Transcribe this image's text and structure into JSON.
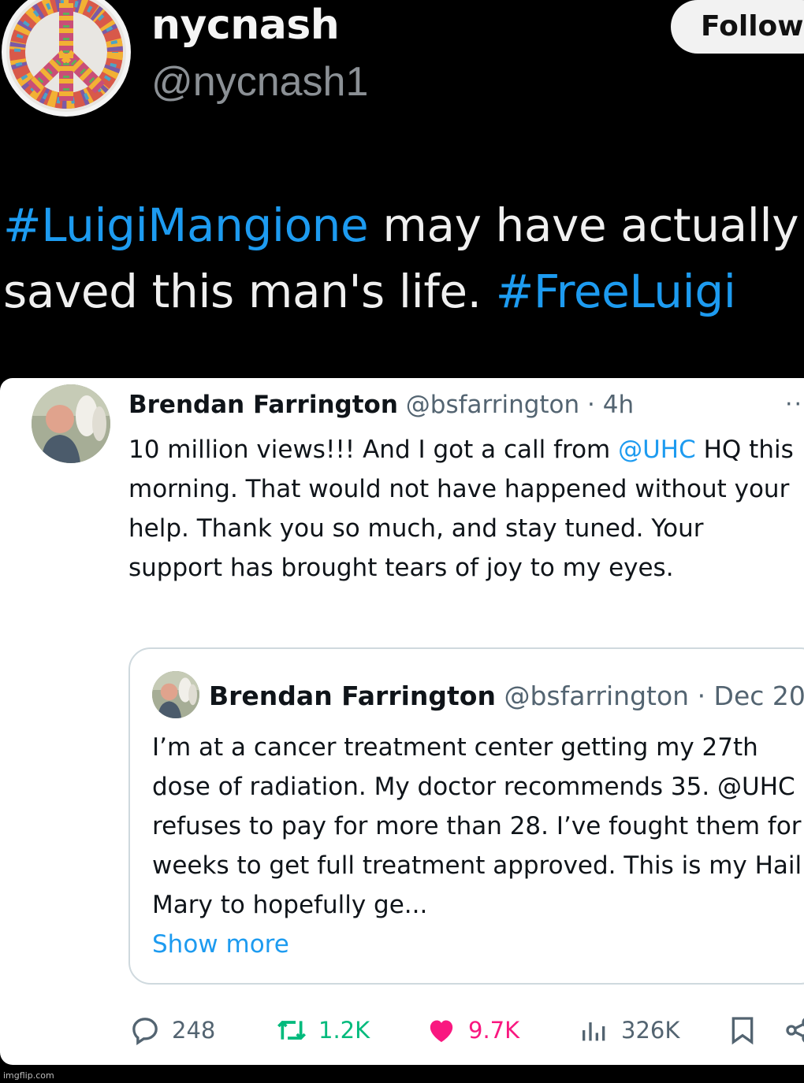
{
  "post": {
    "display_name": "nycnash",
    "handle": "@nycnash1",
    "follow_label": "Follow",
    "avatar_icon": "peace-sign-icon",
    "text": {
      "hashtag_1": "#LuigiMangione",
      "middle": " may have actually saved this man's life. ",
      "hashtag_2": "#FreeLuigi"
    }
  },
  "embedded_tweet": {
    "name": "Brendan Farrington",
    "meta": "@bsfarrington · 4h",
    "more_icon": "more-dots-icon",
    "body": {
      "before_mention": "10 million views!!! And I got a call from ",
      "mention": "@UHC",
      "after_mention": " HQ this morning. That would not have happened without your help. Thank you so much, and stay tuned. Your support has brought tears of joy to my eyes."
    },
    "quote": {
      "name": "Brendan Farrington",
      "meta": "@bsfarrington · Dec 20",
      "body": "I’m at a cancer treatment center getting my 27th dose of radiation. My doctor recommends 35. @UHC refuses to pay for more than 28. I’ve fought them for weeks to get full treatment approved. This is my Hail Mary to hopefully ge...",
      "show_more": "Show more"
    },
    "actions": {
      "replies": "248",
      "retweets": "1.2K",
      "likes": "9.7K",
      "views": "326K"
    }
  },
  "watermark": "imgflip.com",
  "colors": {
    "accent": "#1d9bf0",
    "retweet": "#00ba7c",
    "like": "#f91880",
    "muted": "#536471"
  }
}
